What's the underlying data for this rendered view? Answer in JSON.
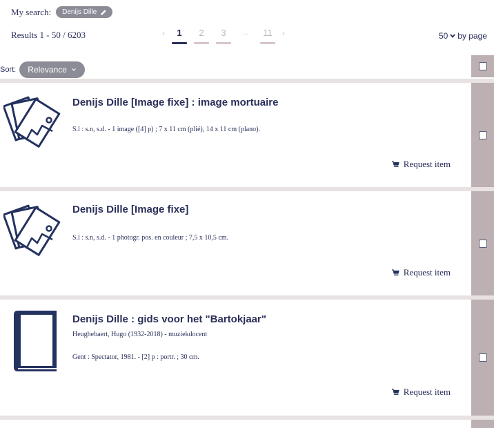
{
  "search": {
    "label": "My search:",
    "chip": "Denijs Dille"
  },
  "results": {
    "text": "Results 1 - 50 / 6203"
  },
  "pagination": {
    "prev": "‹",
    "pages": [
      "1",
      "2",
      "3"
    ],
    "dots": "...",
    "last": "11",
    "next": "›"
  },
  "per_page": {
    "value": "50",
    "label": "by page"
  },
  "sort": {
    "label": "Sort:",
    "value": "Relevance"
  },
  "records": [
    {
      "title": "Denijs Dille [Image fixe] : image mortuaire",
      "author": "",
      "desc": "S.l : s.n, s.d. - 1 image ([4] p) ; 7 x 11 cm (plié), 14 x 11 cm (plano).",
      "request": "Request item",
      "icon": "image-stack-icon"
    },
    {
      "title": "Denijs Dille [Image fixe]",
      "author": "",
      "desc": "S.l : s.n, s.d. - 1 photogr. pos. en couleur ; 7,5 x 10,5 cm.",
      "request": "Request item",
      "icon": "image-stack-icon"
    },
    {
      "title": "Denijs Dille : gids voor het \"Bartokjaar\"",
      "author": "Heughebaert, Hugo (1932-2018) - muziekdocent",
      "desc": "Gent : Spectator, 1981. - [2] p : portr. ; 30 cm.",
      "request": "Request item",
      "icon": "book-icon"
    }
  ],
  "colors": {
    "navy": "#2a2f5a",
    "chip_gray": "#8b8c96",
    "side_panel": "#bdb0b2",
    "separator": "#e8e2e3"
  }
}
